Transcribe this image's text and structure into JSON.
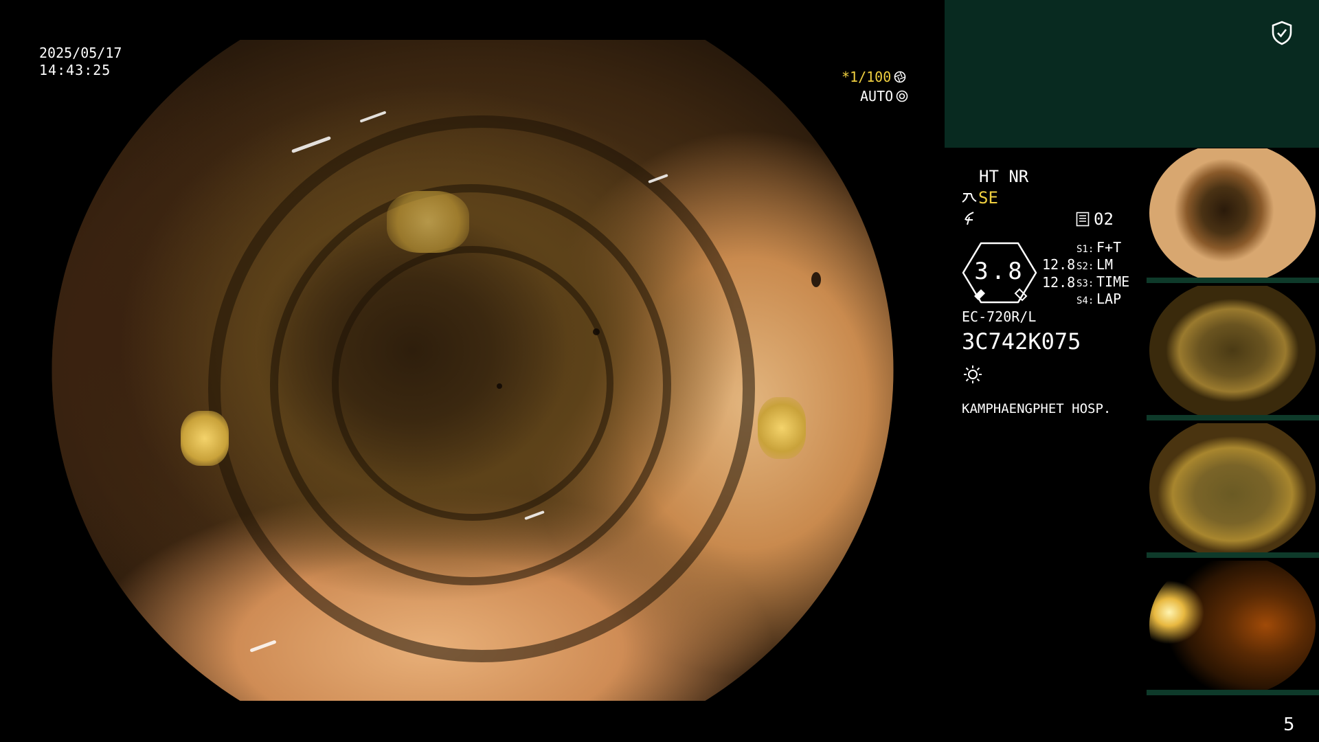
{
  "overlay": {
    "date": "2025/05/17",
    "time": "14:43:25",
    "shutter": "*1/100",
    "iris": "AUTO"
  },
  "status": {
    "ht_nr": "HT NR",
    "se": "SE",
    "record_no": "02",
    "gauge_value": "3.8",
    "gauge_left": "12.8",
    "gauge_right": "12.8",
    "switches": [
      {
        "key": "S1:",
        "value": "F+T"
      },
      {
        "key": "S2:",
        "value": "LM"
      },
      {
        "key": "S3:",
        "value": "TIME"
      },
      {
        "key": "S4:",
        "value": "LAP"
      }
    ],
    "scope_model": "EC-720R/L",
    "serial": "3C742K075",
    "hospital": "KAMPHAENGPHET HOSP."
  },
  "page_number": "5",
  "icons": {
    "shield": "shield-check-icon",
    "shutter": "aperture-icon",
    "iris": "iris-icon",
    "light": "sun-icon",
    "record": "record-icon"
  },
  "colors": {
    "panel": "#082a20",
    "accent_yellow": "#f0d040"
  }
}
